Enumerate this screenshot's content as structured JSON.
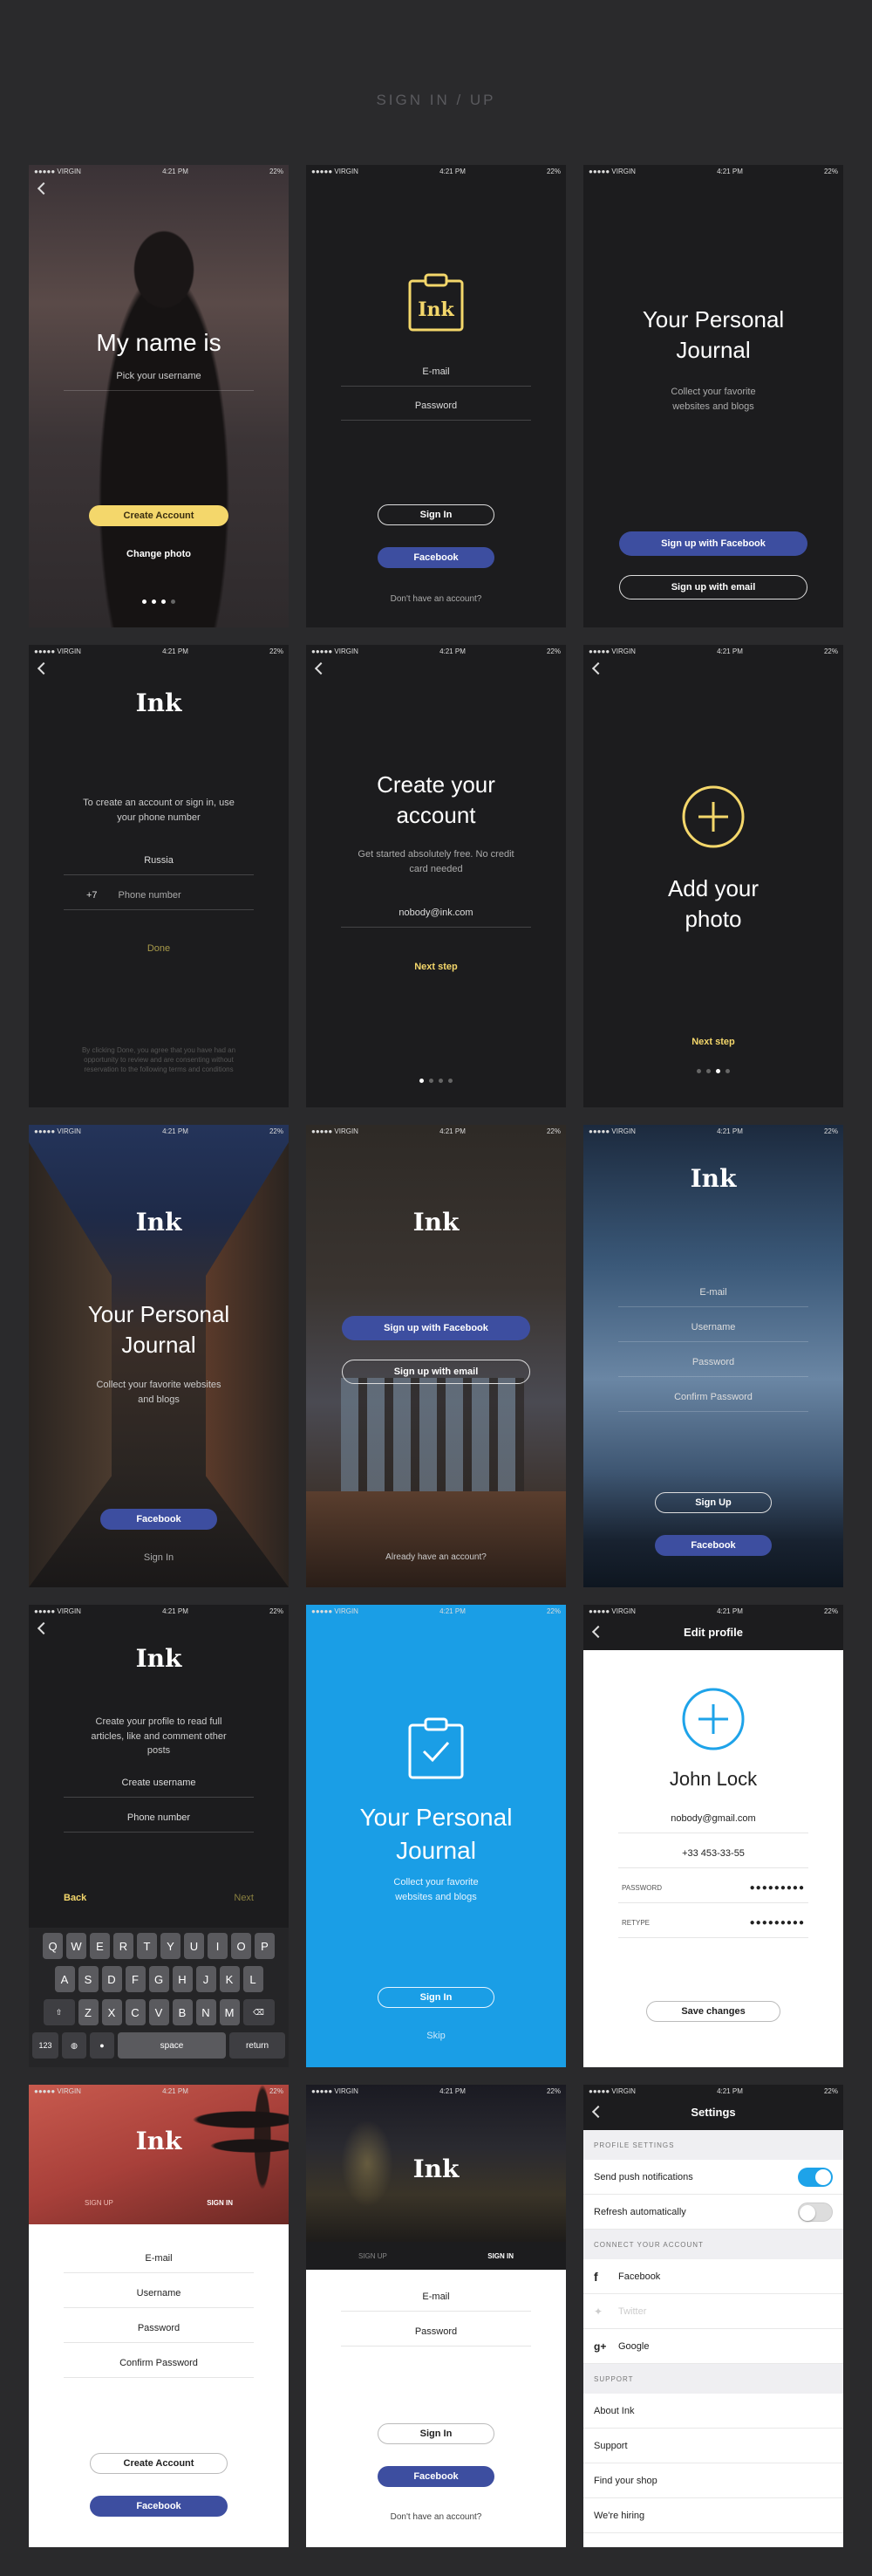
{
  "page": {
    "title": "SIGN IN / UP"
  },
  "status": {
    "carrier": "●●●●● VIRGIN ",
    "time": "4:21 PM",
    "battery": "22%"
  },
  "s1": {
    "heading": "My name is",
    "placeholder": "Pick your username",
    "create": "Create Account",
    "change": "Change photo"
  },
  "s2": {
    "email": "E-mail",
    "password": "Password",
    "signin": "Sign In",
    "facebook": "Facebook",
    "noacc": "Don't have an account?"
  },
  "s3": {
    "heading": "Your Personal Journal",
    "sub": "Collect your favorite websites and blogs",
    "fb": "Sign up with Facebook",
    "email": "Sign up with email"
  },
  "s4": {
    "logo": "Ink",
    "text": "To create an account or sign in, use your phone number",
    "country": "Russia",
    "code": "+7",
    "phone": "Phone number",
    "done": "Done",
    "legal": "By clicking Done, you agree that you have had an opportunity to review and are consenting without reservation to the following terms and conditions"
  },
  "s5": {
    "heading": "Create your account",
    "sub": "Get started absolutely free. No credit card needed",
    "email": "nobody@ink.com",
    "next": "Next step"
  },
  "s6": {
    "heading": "Add your photo",
    "next": "Next step"
  },
  "s7": {
    "logo": "Ink",
    "heading": "Your Personal Journal",
    "sub": "Collect your favorite websites and blogs",
    "facebook": "Facebook",
    "signin": "Sign In"
  },
  "s8": {
    "logo": "Ink",
    "fb": "Sign up with Facebook",
    "email": "Sign up with email",
    "already": "Already have an account?"
  },
  "s9": {
    "logo": "Ink",
    "email": "E-mail",
    "username": "Username",
    "password": "Password",
    "confirm": "Confirm Password",
    "signup": "Sign Up",
    "facebook": "Facebook"
  },
  "s10": {
    "logo": "Ink",
    "text": "Create your profile to read full articles, like and comment other posts",
    "username": "Create username",
    "phone": "Phone number",
    "back": "Back",
    "next": "Next",
    "keys": {
      "r1": [
        "Q",
        "W",
        "E",
        "R",
        "T",
        "Y",
        "U",
        "I",
        "O",
        "P"
      ],
      "r2": [
        "A",
        "S",
        "D",
        "F",
        "G",
        "H",
        "J",
        "K",
        "L"
      ],
      "r3": [
        "Z",
        "X",
        "C",
        "V",
        "B",
        "N",
        "M"
      ],
      "num": "123",
      "space": "space",
      "ret": "return"
    }
  },
  "s11": {
    "heading": "Your Personal Journal",
    "sub": "Collect your favorite websites and blogs",
    "signin": "Sign In",
    "skip": "Skip"
  },
  "s12": {
    "title": "Edit profile",
    "name": "John Lock",
    "email": "nobody@gmail.com",
    "phone": "+33 453-33-55",
    "pw_label": "PASSWORD",
    "pw": "●●●●●●●●●",
    "retype_label": "RETYPE",
    "retype": "●●●●●●●●●",
    "save": "Save changes"
  },
  "s13": {
    "logo": "Ink",
    "tab_up": "SIGN UP",
    "tab_in": "SIGN IN",
    "email": "E-mail",
    "username": "Username",
    "password": "Password",
    "confirm": "Confirm Password",
    "create": "Create Account",
    "facebook": "Facebook"
  },
  "s14": {
    "logo": "Ink",
    "tab_up": "SIGN UP",
    "tab_in": "SIGN IN",
    "email": "E-mail",
    "password": "Password",
    "signin": "Sign In",
    "facebook": "Facebook",
    "noacc": "Don't have an account?"
  },
  "s15": {
    "title": "Settings",
    "h_profile": "PROFILE SETTINGS",
    "push": "Send push notifications",
    "refresh": "Refresh automatically",
    "h_connect": "CONNECT YOUR ACCOUNT",
    "facebook": "Facebook",
    "twitter": "Twitter",
    "google": "Google",
    "h_support": "SUPPORT",
    "about": "About Ink",
    "support": "Support",
    "shop": "Find your shop",
    "hiring": "We're hiring"
  },
  "colors": {
    "accent_yellow": "#f4d76b",
    "facebook": "#3d4ea0",
    "blue": "#1ea3e9"
  }
}
